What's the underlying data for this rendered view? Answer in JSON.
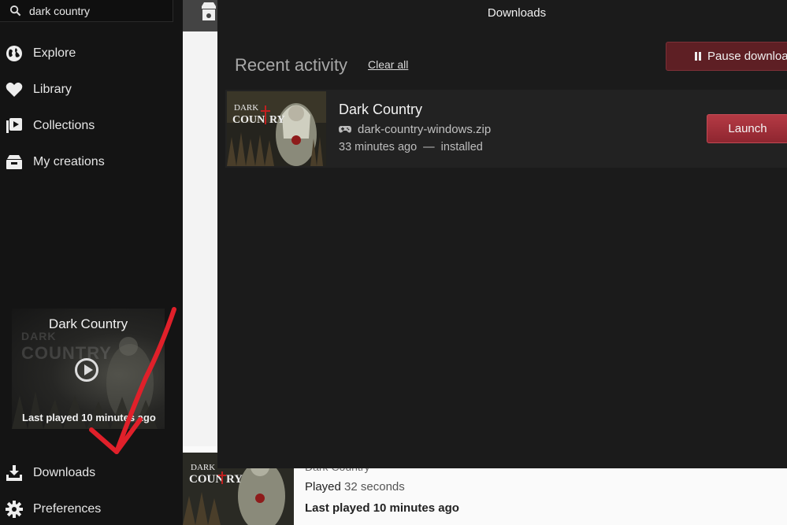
{
  "search": {
    "value": "dark country"
  },
  "nav": {
    "explore": "Explore",
    "library": "Library",
    "collections": "Collections",
    "my_creations": "My creations",
    "downloads": "Downloads",
    "preferences": "Preferences"
  },
  "featured": {
    "title": "Dark Country",
    "last_played": "Last played 10 minutes ago",
    "art_text_top": "DARK",
    "art_text_bottom": "COUNTRY"
  },
  "modal": {
    "title": "Downloads",
    "recent_activity": "Recent activity",
    "clear_all": "Clear all",
    "pause_label": "Pause downloads",
    "item": {
      "title": "Dark Country",
      "file": "dark-country-windows.zip",
      "time": "33 minutes ago",
      "separator": "—",
      "status": "installed",
      "launch_label": "Launch"
    }
  },
  "bottom_card": {
    "title": "Dark Country",
    "played_label": "Played",
    "played_value": "32 seconds",
    "last_played": "Last played 10 minutes ago"
  },
  "colors": {
    "accent_red": "#b53a44",
    "pause_red": "#5e1f24",
    "annotation_red": "#e0202a"
  }
}
